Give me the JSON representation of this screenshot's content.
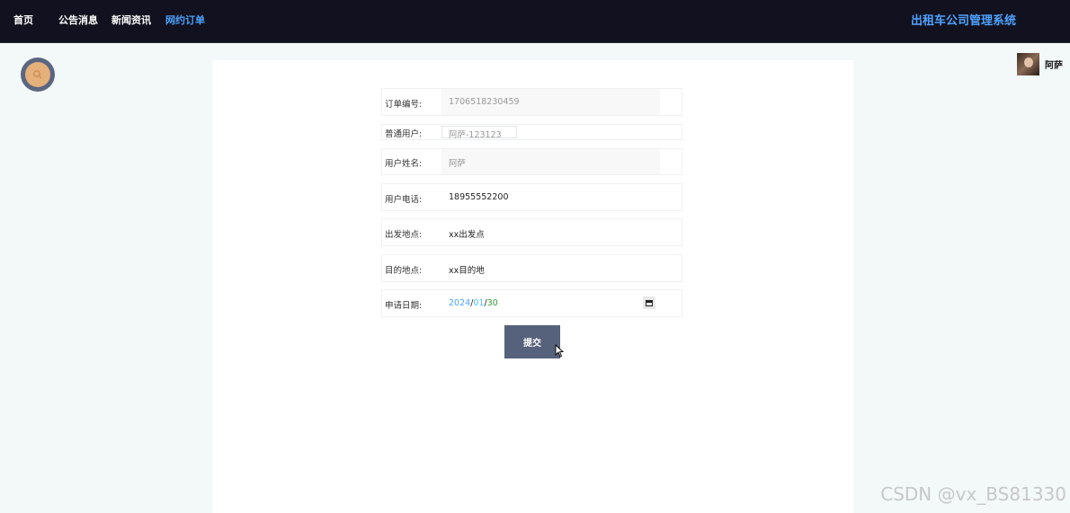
{
  "nav": {
    "items": [
      {
        "label": "首页"
      },
      {
        "label": "公告消息"
      },
      {
        "label": "新闻资讯"
      },
      {
        "label": "网约订单"
      }
    ],
    "brand": "出租车公司管理系统"
  },
  "user": {
    "name": "阿萨"
  },
  "form": {
    "order_no": {
      "label": "订单编号:",
      "value": "1706518230459"
    },
    "user_select": {
      "label": "普通用户:",
      "value": "阿萨-123123"
    },
    "user_name": {
      "label": "用户姓名:",
      "value": "阿萨"
    },
    "user_phone": {
      "label": "用户电话:",
      "value": "18955552200"
    },
    "start": {
      "label": "出发地点:",
      "value": "xx出发点"
    },
    "destination": {
      "label": "目的地点:",
      "value": "xx目的地"
    },
    "apply_date": {
      "label": "申请日期:",
      "year": "2024",
      "month": "01",
      "day": "30",
      "sep": "/"
    },
    "submit_label": "提交"
  },
  "watermark": "CSDN @vx_BS81330",
  "colors": {
    "topbar": "#12111f",
    "accent": "#4ea3ff",
    "button": "#56617b"
  }
}
